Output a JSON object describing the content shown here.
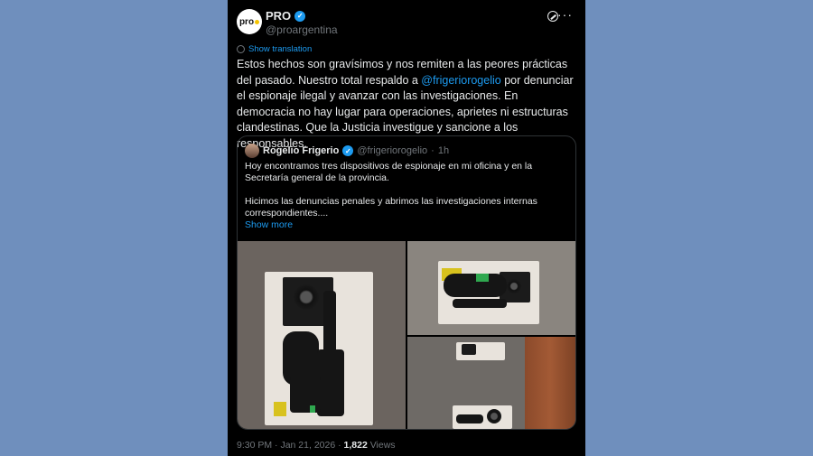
{
  "author": {
    "name": "PRO",
    "handle": "@proargentina",
    "avatar_text": "pro"
  },
  "show_translation": "Show translation",
  "tweet": {
    "text_1": "Estos hechos son gravísimos y nos remiten a las peores prácticas del pasado. Nuestro total respaldo a ",
    "mention": "@frigeriorogelio",
    "text_2": " por denunciar el espionaje ilegal y avanzar con las investigaciones. En democracia no hay lugar para operaciones, aprietes ni estructuras clandestinas. Que la Justicia investigue y sancione a los responsables."
  },
  "quote": {
    "name": "Rogelio Frigerio",
    "handle": "@frigeriorogelio",
    "separator": "·",
    "time": "1h",
    "paragraph_1": "Hoy encontramos tres dispositivos de espionaje en mi oficina y en la Secretaría general de la provincia.",
    "paragraph_2": "Hicimos las denuncias penales y abrimos las investigaciones internas correspondientes....",
    "show_more": "Show more"
  },
  "footer": {
    "time": "9:30 PM",
    "separator": "·",
    "date": "Jan 21, 2026",
    "separator_2": "·",
    "views_count": "1,822",
    "views_label": "Views"
  },
  "colors": {
    "background": "#6f8fbd",
    "card": "#000000",
    "accent": "#1d9bf0"
  },
  "icons": [
    "verified-badge-icon",
    "grok-icon",
    "more-options-icon",
    "globe-icon"
  ]
}
